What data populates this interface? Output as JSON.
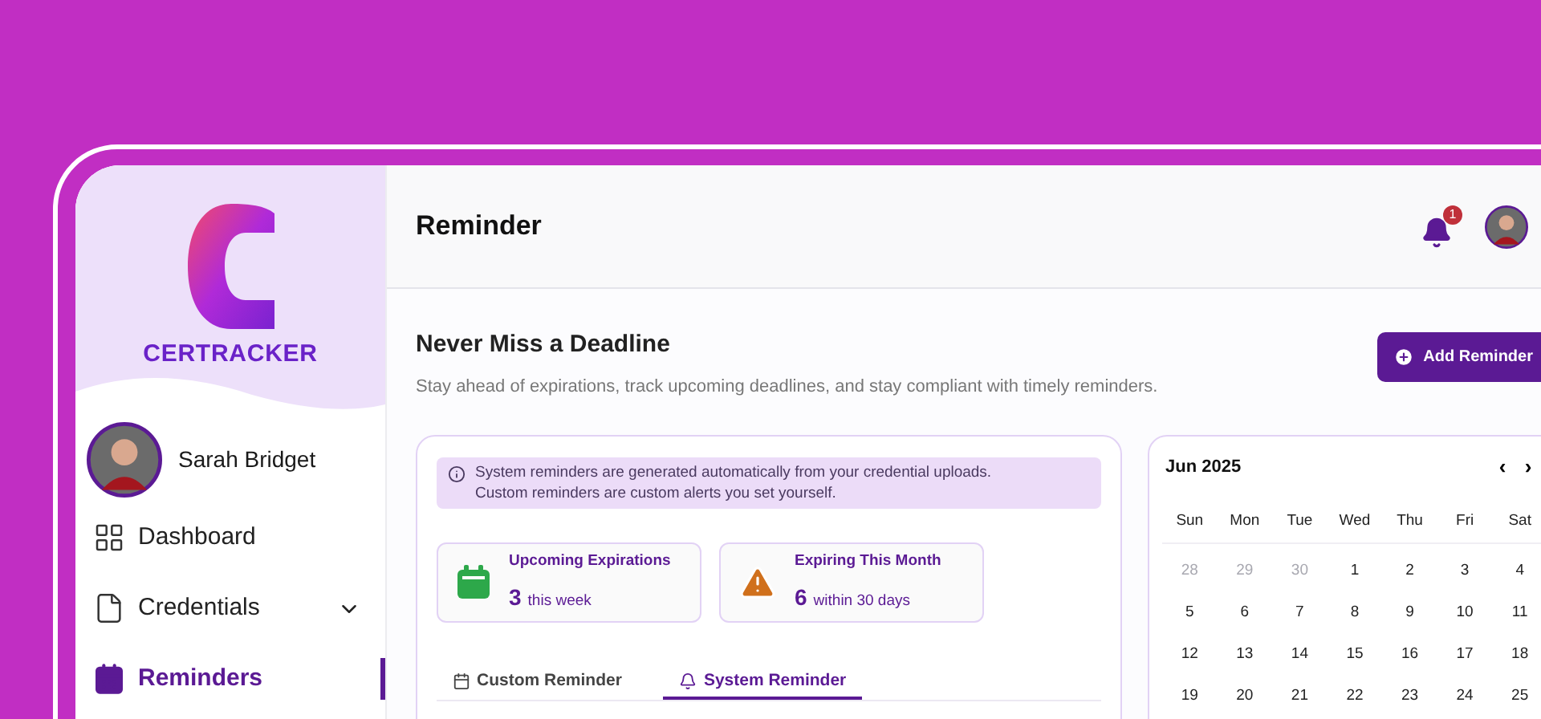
{
  "sidebar": {
    "brand": "CERTRACKER",
    "user": {
      "name": "Sarah Bridget"
    },
    "items": [
      {
        "label": "Dashboard",
        "selected": false,
        "expandable": false
      },
      {
        "label": "Credentials",
        "selected": false,
        "expandable": true
      },
      {
        "label": "Reminders",
        "selected": true,
        "expandable": false
      }
    ]
  },
  "header": {
    "title": "Reminder",
    "notification_count": "1"
  },
  "intro": {
    "title": "Never Miss a Deadline",
    "subtitle": "Stay ahead of expirations, track upcoming deadlines, and stay compliant with timely reminders.",
    "button": "Add Reminder"
  },
  "info_banner": {
    "lines": [
      "System reminders are generated automatically from your credential uploads.",
      "Custom reminders are custom alerts you set yourself."
    ]
  },
  "stats": [
    {
      "kind": "calendar",
      "label": "Upcoming Expirations",
      "value": "3",
      "unit": "this week"
    },
    {
      "kind": "warning",
      "label": "Expiring This Month",
      "value": "6",
      "unit": "within 30 days"
    }
  ],
  "tabs": [
    {
      "label": "Custom Reminder",
      "selected": false
    },
    {
      "label": "System Reminder",
      "selected": true
    }
  ],
  "calendar": {
    "month": "Jun 2025",
    "prev": "‹",
    "next": "›",
    "weekdays": [
      "Sun",
      "Mon",
      "Tue",
      "Wed",
      "Thu",
      "Fri",
      "Sat"
    ],
    "weeks": [
      [
        {
          "day": "28",
          "outside": true
        },
        {
          "day": "29",
          "outside": true
        },
        {
          "day": "30",
          "outside": true
        },
        {
          "day": "1",
          "outside": false
        },
        {
          "day": "2",
          "outside": false
        },
        {
          "day": "3",
          "outside": false
        },
        {
          "day": "4",
          "outside": false
        }
      ],
      [
        {
          "day": "5",
          "outside": false
        },
        {
          "day": "6",
          "outside": false
        },
        {
          "day": "7",
          "outside": false
        },
        {
          "day": "8",
          "outside": false
        },
        {
          "day": "9",
          "outside": false
        },
        {
          "day": "10",
          "outside": false
        },
        {
          "day": "11",
          "outside": false
        }
      ],
      [
        {
          "day": "12",
          "outside": false
        },
        {
          "day": "13",
          "outside": false
        },
        {
          "day": "14",
          "outside": false
        },
        {
          "day": "15",
          "outside": false
        },
        {
          "day": "16",
          "outside": false
        },
        {
          "day": "17",
          "outside": false
        },
        {
          "day": "18",
          "outside": false
        }
      ],
      [
        {
          "day": "19",
          "outside": false
        },
        {
          "day": "20",
          "outside": false
        },
        {
          "day": "21",
          "outside": false
        },
        {
          "day": "22",
          "outside": false
        },
        {
          "day": "23",
          "outside": false
        },
        {
          "day": "24",
          "outside": false
        },
        {
          "day": "25",
          "outside": false
        }
      ]
    ]
  }
}
